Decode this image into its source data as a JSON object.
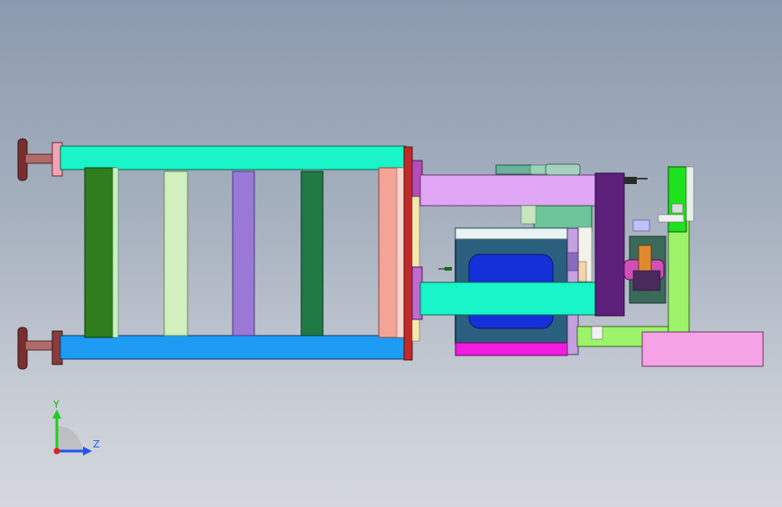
{
  "view": {
    "background_top": "#8b9aae",
    "background_bottom": "#d4d8de"
  },
  "triad": {
    "y_label": "Y",
    "z_label": "Z",
    "y_color": "#22cc22",
    "z_color": "#2255ee",
    "origin_color": "#dd2222"
  },
  "parts": {
    "tie_bar_top_color": "#19f5c8",
    "tie_bar_bottom_color": "#1e9bf5",
    "end_knob_color": "#8a3b3b",
    "spacer_colors": [
      "#2e7d1e",
      "#d2efc0",
      "#9a78d8",
      "#1f7a44"
    ],
    "end_plate_color": "#f4a497",
    "platen_color": "#c22a2a",
    "arm_upper_color": "#e0a6f5",
    "arm_lower_color": "#19f5c8",
    "mold_box_color": "#2a5f80",
    "mold_cavity_color": "#1530d8",
    "mold_base_color": "#f21be0",
    "bracket_color": "#9df46a",
    "pad_color": "#f5a3e6",
    "column_dark_color": "#5c1f7a",
    "green_plate_color": "#1ee21e"
  }
}
